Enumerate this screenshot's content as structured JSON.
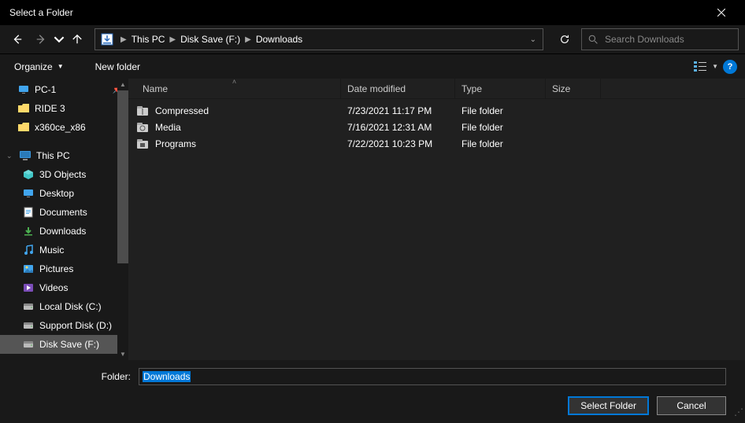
{
  "title": "Select a Folder",
  "breadcrumbs": {
    "root": "This PC",
    "drive": "Disk Save (F:)",
    "folder": "Downloads"
  },
  "search": {
    "placeholder": "Search Downloads"
  },
  "toolbar": {
    "organize": "Organize",
    "newfolder": "New folder"
  },
  "sidebar": {
    "quick": [
      {
        "label": "PC-1",
        "pinned": true
      },
      {
        "label": "RIDE 3"
      },
      {
        "label": "x360ce_x86"
      }
    ],
    "thispc_label": "This PC",
    "thispc": [
      {
        "label": "3D Objects"
      },
      {
        "label": "Desktop"
      },
      {
        "label": "Documents"
      },
      {
        "label": "Downloads"
      },
      {
        "label": "Music"
      },
      {
        "label": "Pictures"
      },
      {
        "label": "Videos"
      },
      {
        "label": "Local Disk (C:)"
      },
      {
        "label": "Support Disk (D:)"
      },
      {
        "label": "Disk Save (F:)",
        "selected": true
      }
    ]
  },
  "columns": {
    "name": "Name",
    "date": "Date modified",
    "type": "Type",
    "size": "Size"
  },
  "files": [
    {
      "name": "Compressed",
      "date": "7/23/2021 11:17 PM",
      "type": "File folder",
      "icon": "compressed"
    },
    {
      "name": "Media",
      "date": "7/16/2021 12:31 AM",
      "type": "File folder",
      "icon": "media"
    },
    {
      "name": "Programs",
      "date": "7/22/2021 10:23 PM",
      "type": "File folder",
      "icon": "programs"
    }
  ],
  "footer": {
    "folder_label": "Folder:",
    "folder_value": "Downloads",
    "select": "Select Folder",
    "cancel": "Cancel"
  }
}
